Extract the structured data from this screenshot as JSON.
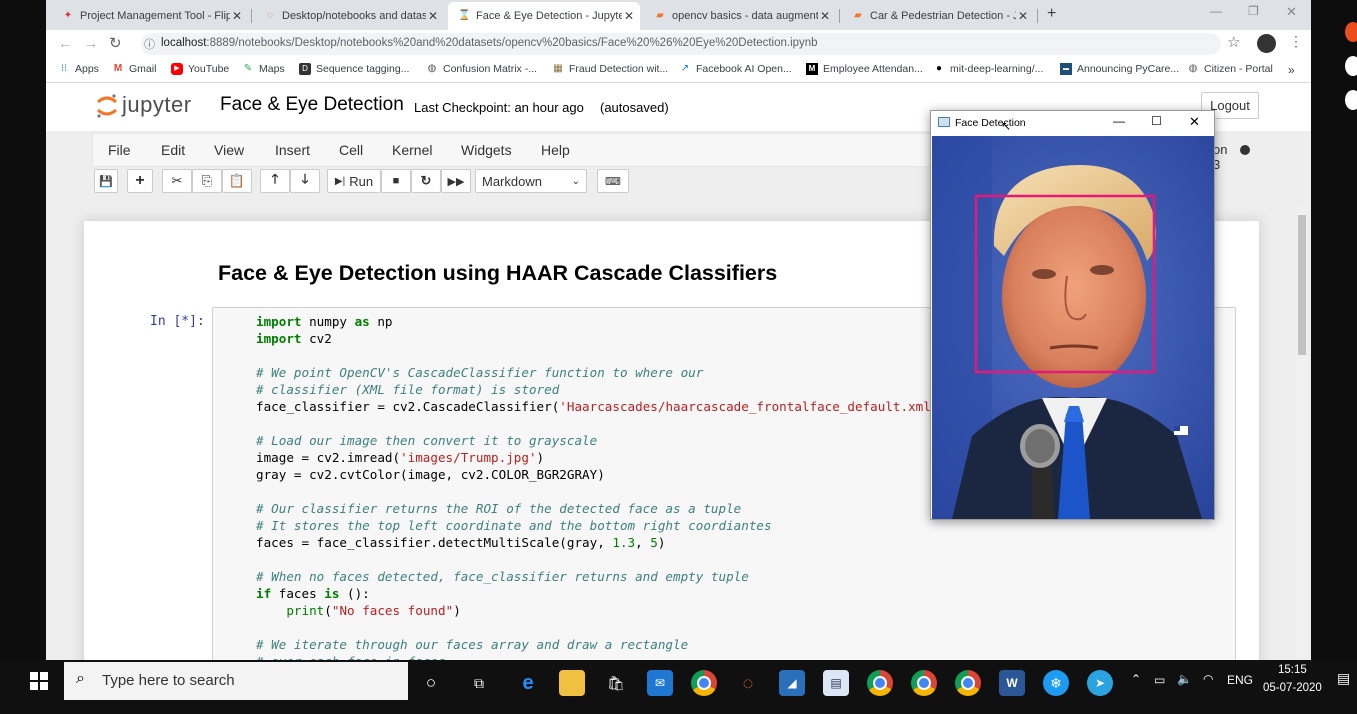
{
  "browser": {
    "tabs": [
      {
        "title": "Project Management Tool - Flip F",
        "icon": "flipkart-icon",
        "active": false
      },
      {
        "title": "Desktop/notebooks and datasets",
        "icon": "jupyter-icon",
        "active": false
      },
      {
        "title": "Face & Eye Detection - Jupyter N",
        "icon": "jupyter-icon",
        "active": true
      },
      {
        "title": "opencv basics - data augmentati",
        "icon": "jupyter-icon",
        "active": false
      },
      {
        "title": "Car & Pedestrian Detection - Jup",
        "icon": "jupyter-icon",
        "active": false
      }
    ],
    "url_host": "localhost",
    "url_rest": ":8889/notebooks/Desktop/notebooks%20and%20datasets/opencv%20basics/Face%20%26%20Eye%20Detection.ipynb",
    "bookmarks": [
      {
        "label": "Apps",
        "icon": "apps-grid-icon",
        "color": "#1a73e8"
      },
      {
        "label": "Gmail",
        "icon": "gmail-icon",
        "color": "#ea4335"
      },
      {
        "label": "YouTube",
        "icon": "youtube-icon",
        "color": "#ff0000"
      },
      {
        "label": "Maps",
        "icon": "maps-icon",
        "color": "#34a853"
      },
      {
        "label": "Sequence tagging...",
        "icon": "dataset-icon",
        "color": "#333333"
      },
      {
        "label": "Confusion Matrix -...",
        "icon": "globe-icon",
        "color": "#555555"
      },
      {
        "label": "Fraud Detection wit...",
        "icon": "image-icon",
        "color": "#8a6d3b"
      },
      {
        "label": "Facebook AI Open...",
        "icon": "chart-icon",
        "color": "#1a73e8"
      },
      {
        "label": "Employee Attendan...",
        "icon": "medium-icon",
        "color": "#000000"
      },
      {
        "label": "mit-deep-learning/...",
        "icon": "github-icon",
        "color": "#000000"
      },
      {
        "label": "Announcing PyCare...",
        "icon": "news-icon",
        "color": "#1f4e79"
      },
      {
        "label": "Citizen - Portal",
        "icon": "globe-icon",
        "color": "#555555"
      }
    ],
    "more": "»"
  },
  "jupyter": {
    "logo": "jupyter",
    "notebook_title": "Face & Eye Detection",
    "checkpoint": "Last Checkpoint: an hour ago",
    "autosaved": "(autosaved)",
    "logout": "Logout",
    "kernel": "on 3",
    "menu": [
      "File",
      "Edit",
      "View",
      "Insert",
      "Cell",
      "Kernel",
      "Widgets",
      "Help"
    ],
    "run_label": "Run",
    "cell_type": "Markdown",
    "heading": "Face & Eye Detection using HAAR Cascade Classifiers",
    "prompt": "In [*]:"
  },
  "popup": {
    "title": "Face Detection"
  },
  "taskbar": {
    "search_placeholder": "Type here to search",
    "lang": "ENG",
    "time": "15:15",
    "date": "05-07-2020"
  },
  "colors": {
    "jupyter_orange": "#f37626",
    "detection_box": "#e6197a",
    "taskbar_bg": "#101010"
  }
}
